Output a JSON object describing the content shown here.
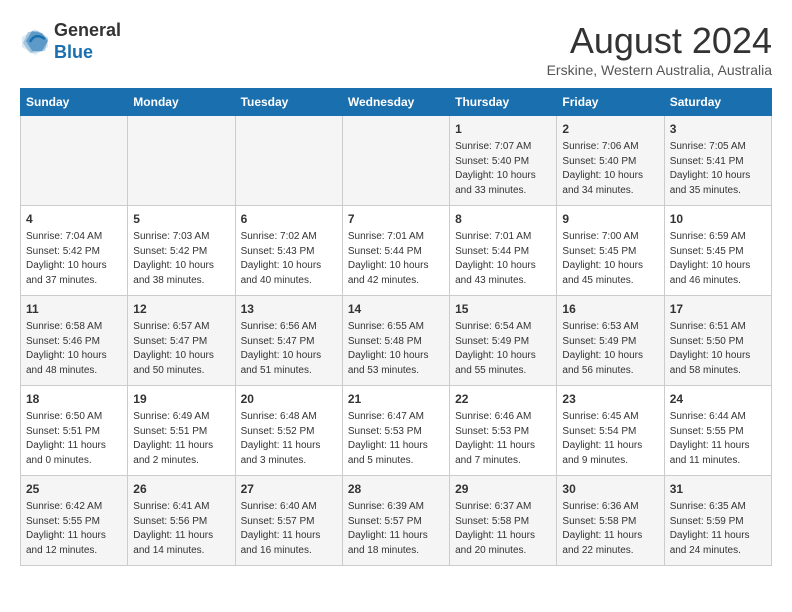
{
  "header": {
    "logo_line1": "General",
    "logo_line2": "Blue",
    "month_year": "August 2024",
    "location": "Erskine, Western Australia, Australia"
  },
  "days_of_week": [
    "Sunday",
    "Monday",
    "Tuesday",
    "Wednesday",
    "Thursday",
    "Friday",
    "Saturday"
  ],
  "weeks": [
    [
      {
        "day": "",
        "info": ""
      },
      {
        "day": "",
        "info": ""
      },
      {
        "day": "",
        "info": ""
      },
      {
        "day": "",
        "info": ""
      },
      {
        "day": "1",
        "info": "Sunrise: 7:07 AM\nSunset: 5:40 PM\nDaylight: 10 hours\nand 33 minutes."
      },
      {
        "day": "2",
        "info": "Sunrise: 7:06 AM\nSunset: 5:40 PM\nDaylight: 10 hours\nand 34 minutes."
      },
      {
        "day": "3",
        "info": "Sunrise: 7:05 AM\nSunset: 5:41 PM\nDaylight: 10 hours\nand 35 minutes."
      }
    ],
    [
      {
        "day": "4",
        "info": "Sunrise: 7:04 AM\nSunset: 5:42 PM\nDaylight: 10 hours\nand 37 minutes."
      },
      {
        "day": "5",
        "info": "Sunrise: 7:03 AM\nSunset: 5:42 PM\nDaylight: 10 hours\nand 38 minutes."
      },
      {
        "day": "6",
        "info": "Sunrise: 7:02 AM\nSunset: 5:43 PM\nDaylight: 10 hours\nand 40 minutes."
      },
      {
        "day": "7",
        "info": "Sunrise: 7:01 AM\nSunset: 5:44 PM\nDaylight: 10 hours\nand 42 minutes."
      },
      {
        "day": "8",
        "info": "Sunrise: 7:01 AM\nSunset: 5:44 PM\nDaylight: 10 hours\nand 43 minutes."
      },
      {
        "day": "9",
        "info": "Sunrise: 7:00 AM\nSunset: 5:45 PM\nDaylight: 10 hours\nand 45 minutes."
      },
      {
        "day": "10",
        "info": "Sunrise: 6:59 AM\nSunset: 5:45 PM\nDaylight: 10 hours\nand 46 minutes."
      }
    ],
    [
      {
        "day": "11",
        "info": "Sunrise: 6:58 AM\nSunset: 5:46 PM\nDaylight: 10 hours\nand 48 minutes."
      },
      {
        "day": "12",
        "info": "Sunrise: 6:57 AM\nSunset: 5:47 PM\nDaylight: 10 hours\nand 50 minutes."
      },
      {
        "day": "13",
        "info": "Sunrise: 6:56 AM\nSunset: 5:47 PM\nDaylight: 10 hours\nand 51 minutes."
      },
      {
        "day": "14",
        "info": "Sunrise: 6:55 AM\nSunset: 5:48 PM\nDaylight: 10 hours\nand 53 minutes."
      },
      {
        "day": "15",
        "info": "Sunrise: 6:54 AM\nSunset: 5:49 PM\nDaylight: 10 hours\nand 55 minutes."
      },
      {
        "day": "16",
        "info": "Sunrise: 6:53 AM\nSunset: 5:49 PM\nDaylight: 10 hours\nand 56 minutes."
      },
      {
        "day": "17",
        "info": "Sunrise: 6:51 AM\nSunset: 5:50 PM\nDaylight: 10 hours\nand 58 minutes."
      }
    ],
    [
      {
        "day": "18",
        "info": "Sunrise: 6:50 AM\nSunset: 5:51 PM\nDaylight: 11 hours\nand 0 minutes."
      },
      {
        "day": "19",
        "info": "Sunrise: 6:49 AM\nSunset: 5:51 PM\nDaylight: 11 hours\nand 2 minutes."
      },
      {
        "day": "20",
        "info": "Sunrise: 6:48 AM\nSunset: 5:52 PM\nDaylight: 11 hours\nand 3 minutes."
      },
      {
        "day": "21",
        "info": "Sunrise: 6:47 AM\nSunset: 5:53 PM\nDaylight: 11 hours\nand 5 minutes."
      },
      {
        "day": "22",
        "info": "Sunrise: 6:46 AM\nSunset: 5:53 PM\nDaylight: 11 hours\nand 7 minutes."
      },
      {
        "day": "23",
        "info": "Sunrise: 6:45 AM\nSunset: 5:54 PM\nDaylight: 11 hours\nand 9 minutes."
      },
      {
        "day": "24",
        "info": "Sunrise: 6:44 AM\nSunset: 5:55 PM\nDaylight: 11 hours\nand 11 minutes."
      }
    ],
    [
      {
        "day": "25",
        "info": "Sunrise: 6:42 AM\nSunset: 5:55 PM\nDaylight: 11 hours\nand 12 minutes."
      },
      {
        "day": "26",
        "info": "Sunrise: 6:41 AM\nSunset: 5:56 PM\nDaylight: 11 hours\nand 14 minutes."
      },
      {
        "day": "27",
        "info": "Sunrise: 6:40 AM\nSunset: 5:57 PM\nDaylight: 11 hours\nand 16 minutes."
      },
      {
        "day": "28",
        "info": "Sunrise: 6:39 AM\nSunset: 5:57 PM\nDaylight: 11 hours\nand 18 minutes."
      },
      {
        "day": "29",
        "info": "Sunrise: 6:37 AM\nSunset: 5:58 PM\nDaylight: 11 hours\nand 20 minutes."
      },
      {
        "day": "30",
        "info": "Sunrise: 6:36 AM\nSunset: 5:58 PM\nDaylight: 11 hours\nand 22 minutes."
      },
      {
        "day": "31",
        "info": "Sunrise: 6:35 AM\nSunset: 5:59 PM\nDaylight: 11 hours\nand 24 minutes."
      }
    ]
  ]
}
